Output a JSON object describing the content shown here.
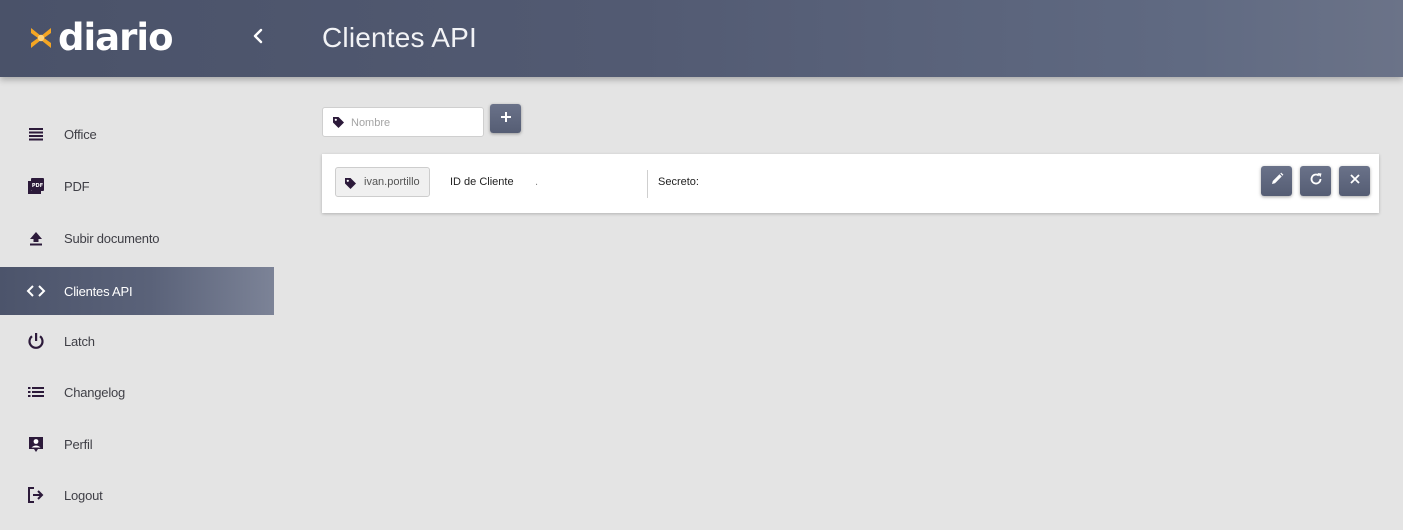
{
  "app": {
    "logo_text": "diario",
    "page_title": "Clientes API"
  },
  "sidebar": {
    "items": [
      {
        "label": "Office",
        "icon": "office-lines-icon",
        "active": false
      },
      {
        "label": "PDF",
        "icon": "pdf-icon",
        "active": false
      },
      {
        "label": "Subir documento",
        "icon": "upload-icon",
        "active": false
      },
      {
        "label": "Clientes API",
        "icon": "code-icon",
        "active": true
      },
      {
        "label": "Latch",
        "icon": "power-icon",
        "active": false
      },
      {
        "label": "Changelog",
        "icon": "list-icon",
        "active": false
      },
      {
        "label": "Perfil",
        "icon": "profile-icon",
        "active": false
      },
      {
        "label": "Logout",
        "icon": "logout-icon",
        "active": false
      }
    ]
  },
  "toolbar": {
    "name_value": "",
    "name_placeholder": "Nombre",
    "add_button_label": "+"
  },
  "clients": [
    {
      "name": "ivan.portillo",
      "client_id_label": "ID de Cliente",
      "client_id_value": ".",
      "secret_label": "Secreto:",
      "actions": [
        "edit-icon",
        "refresh-icon",
        "close-icon"
      ]
    }
  ],
  "colors": {
    "header_start": "#4a5269",
    "header_end": "#6b7388",
    "logo_accent": "#f5a623",
    "icon_purple": "#2c1a3a",
    "background": "#e4e4e4"
  }
}
